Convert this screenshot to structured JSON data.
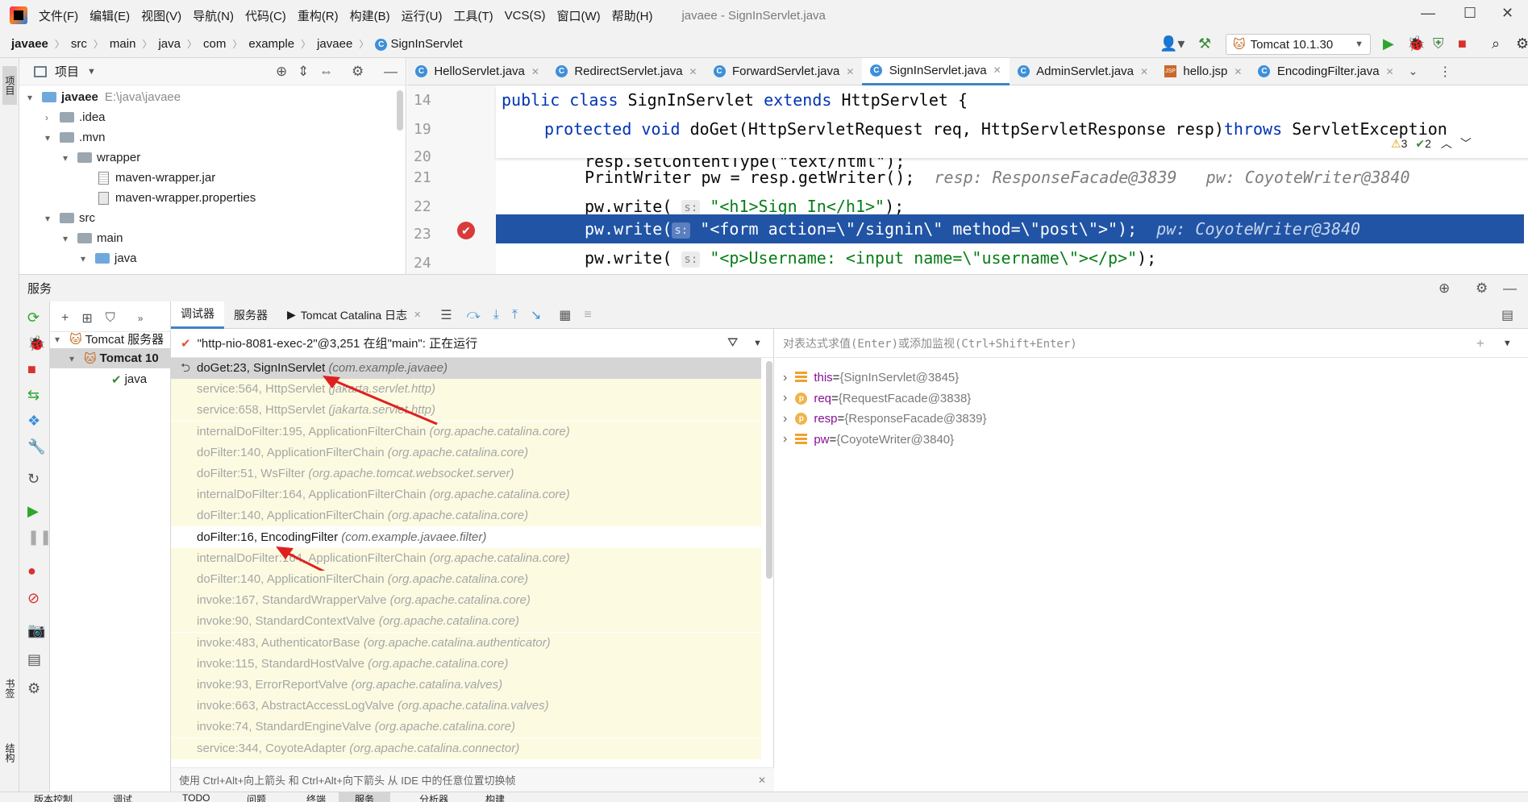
{
  "menubar": {
    "items": [
      "文件(F)",
      "编辑(E)",
      "视图(V)",
      "导航(N)",
      "代码(C)",
      "重构(R)",
      "构建(B)",
      "运行(U)",
      "工具(T)",
      "VCS(S)",
      "窗口(W)",
      "帮助(H)"
    ],
    "title": "javaee - SignInServlet.java"
  },
  "navbar": {
    "crumbs": [
      "javaee",
      "src",
      "main",
      "java",
      "com",
      "example",
      "javaee",
      "SignInServlet"
    ],
    "run_config": "Tomcat 10.1.30"
  },
  "project": {
    "title": "项目",
    "strip_label": "项目",
    "tree": [
      {
        "name": "javaee",
        "extra": "E:\\java\\javaee",
        "bold": true
      },
      {
        "name": ".idea"
      },
      {
        "name": ".mvn"
      },
      {
        "name": "wrapper"
      },
      {
        "name": "maven-wrapper.jar"
      },
      {
        "name": "maven-wrapper.properties"
      },
      {
        "name": "src"
      },
      {
        "name": "main"
      },
      {
        "name": "java"
      }
    ]
  },
  "editor": {
    "tabs": [
      "HelloServlet.java",
      "RedirectServlet.java",
      "ForwardServlet.java",
      "SignInServlet.java",
      "AdminServlet.java",
      "hello.jsp",
      "EncodingFilter.java"
    ],
    "warnings": "3",
    "checks": "2",
    "lines": [
      {
        "num": "14",
        "kw1": "public class ",
        "plain1": "SignInServlet ",
        "kw2": "extends ",
        "plain2": "HttpServlet {"
      },
      {
        "num": "19",
        "kw1": "protected void ",
        "plain1": "doGet(HttpServletRequest req, HttpServletResponse resp)",
        "kw2": "throws ",
        "plain2": "ServletException"
      },
      {
        "num": "20",
        "text": "resp.setContentType(\"text/html\");"
      },
      {
        "num": "21",
        "text": "PrintWriter pw = resp.getWriter();",
        "hint": "resp: ResponseFacade@3839   pw: CoyoteWriter@3840"
      },
      {
        "num": "22",
        "pre": "pw.write(",
        "param": "s:",
        "str": "\"<h1>Sign In</h1>\"",
        "post": ");"
      },
      {
        "num": "23",
        "pre": "pw.write(",
        "param": "s:",
        "str": "\"<form action=\\\"/signin\\\" method=\\\"post\\\">\"",
        "post": ");",
        "hint": "pw: CoyoteWriter@3840"
      },
      {
        "num": "24",
        "pre": "pw.write(",
        "param": "s:",
        "str": "\"<p>Username: <input name=\\\"username\\\"></p>\"",
        "post": ");"
      }
    ]
  },
  "services": {
    "title": "服务",
    "tree": [
      "Tomcat 服务器",
      "Tomcat 10",
      "java"
    ],
    "tabs": [
      "调试器",
      "服务器",
      "Tomcat Catalina 日志"
    ],
    "thread": "\"http-nio-8081-exec-2\"@3,251 在组\"main\": 正在运行",
    "frames": [
      {
        "m": "doGet:23, SignInServlet",
        "p": "(com.example.javaee)",
        "kind": "sel"
      },
      {
        "m": "service:564, HttpServlet",
        "p": "(jakarta.servlet.http)",
        "kind": "lib"
      },
      {
        "m": "service:658, HttpServlet",
        "p": "(jakarta.servlet.http)",
        "kind": "lib"
      },
      {
        "m": "internalDoFilter:195, ApplicationFilterChain",
        "p": "(org.apache.catalina.core)",
        "kind": "lib"
      },
      {
        "m": "doFilter:140, ApplicationFilterChain",
        "p": "(org.apache.catalina.core)",
        "kind": "lib"
      },
      {
        "m": "doFilter:51, WsFilter",
        "p": "(org.apache.tomcat.websocket.server)",
        "kind": "lib"
      },
      {
        "m": "internalDoFilter:164, ApplicationFilterChain",
        "p": "(org.apache.catalina.core)",
        "kind": "lib"
      },
      {
        "m": "doFilter:140, ApplicationFilterChain",
        "p": "(org.apache.catalina.core)",
        "kind": "lib"
      },
      {
        "m": "doFilter:16, EncodingFilter",
        "p": "(com.example.javaee.filter)",
        "kind": "own"
      },
      {
        "m": "internalDoFilter:164, ApplicationFilterChain",
        "p": "(org.apache.catalina.core)",
        "kind": "lib"
      },
      {
        "m": "doFilter:140, ApplicationFilterChain",
        "p": "(org.apache.catalina.core)",
        "kind": "lib"
      },
      {
        "m": "invoke:167, StandardWrapperValve",
        "p": "(org.apache.catalina.core)",
        "kind": "lib"
      },
      {
        "m": "invoke:90, StandardContextValve",
        "p": "(org.apache.catalina.core)",
        "kind": "lib"
      },
      {
        "m": "invoke:483, AuthenticatorBase",
        "p": "(org.apache.catalina.authenticator)",
        "kind": "lib"
      },
      {
        "m": "invoke:115, StandardHostValve",
        "p": "(org.apache.catalina.core)",
        "kind": "lib"
      },
      {
        "m": "invoke:93, ErrorReportValve",
        "p": "(org.apache.catalina.valves)",
        "kind": "lib"
      },
      {
        "m": "invoke:663, AbstractAccessLogValve",
        "p": "(org.apache.catalina.valves)",
        "kind": "lib"
      },
      {
        "m": "invoke:74, StandardEngineValve",
        "p": "(org.apache.catalina.core)",
        "kind": "lib"
      },
      {
        "m": "service:344, CoyoteAdapter",
        "p": "(org.apache.catalina.connector)",
        "kind": "lib"
      }
    ],
    "hint": "使用 Ctrl+Alt+向上箭头 和 Ctrl+Alt+向下箭头 从 IDE 中的任意位置切换帧",
    "eval_placeholder": "对表达式求值(Enter)或添加监视(Ctrl+Shift+Enter)",
    "vars": [
      {
        "name": "this",
        "value": "{SignInServlet@3845}",
        "icon": "field"
      },
      {
        "name": "req",
        "value": "{RequestFacade@3838}",
        "icon": "param"
      },
      {
        "name": "resp",
        "value": "{ResponseFacade@3839}",
        "icon": "param"
      },
      {
        "name": "pw",
        "value": "{CoyoteWriter@3840}",
        "icon": "field"
      }
    ],
    "left_labels": [
      "书签",
      "结构"
    ]
  },
  "statusbar": [
    "版本控制",
    "调试",
    "TODO",
    "问题",
    "终端",
    "服务",
    "分析器",
    "构建"
  ],
  "colors": {
    "selection": "#2154a5",
    "frame_bg": "#fcfbe1",
    "accent": "#4083c9",
    "arrow": "#e02020"
  }
}
